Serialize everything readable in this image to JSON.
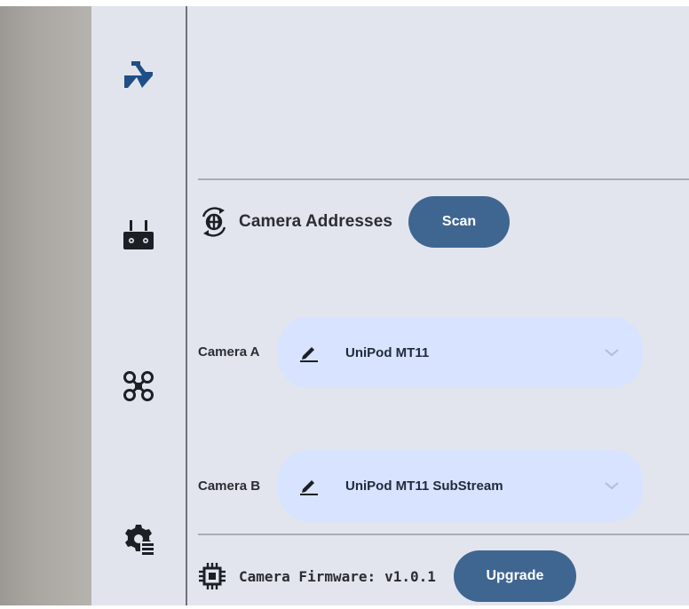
{
  "rail": {
    "items": [
      {
        "icon": "camera-settings-icon"
      },
      {
        "icon": "remote-controller-icon"
      },
      {
        "icon": "drone-icon"
      },
      {
        "icon": "settings-list-icon"
      }
    ]
  },
  "camera_addresses": {
    "title": "Camera Addresses",
    "scan_label": "Scan"
  },
  "cameras": [
    {
      "label": "Camera A",
      "value": "UniPod MT11"
    },
    {
      "label": "Camera B",
      "value": "UniPod MT11 SubStream"
    }
  ],
  "firmware": {
    "label": "Camera Firmware:",
    "version": "v1.0.1",
    "upgrade_label": "Upgrade"
  },
  "colors": {
    "accent": "#3f6690",
    "select_bg": "#d7e3ff",
    "panel_bg": "#e3e5ee"
  }
}
